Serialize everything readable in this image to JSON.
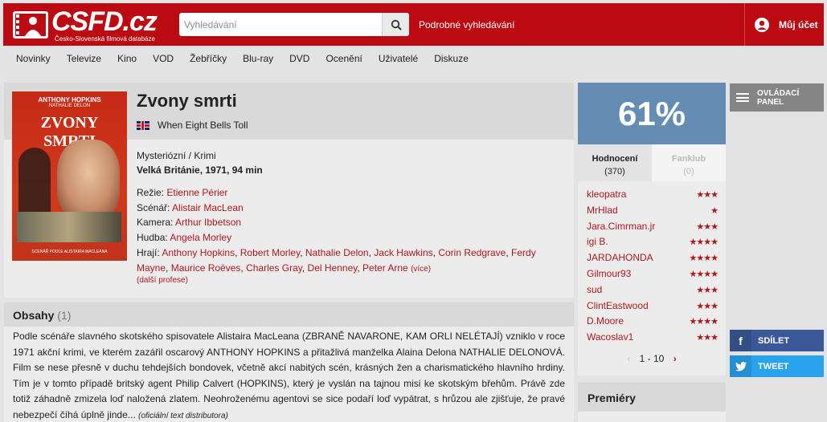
{
  "header": {
    "logo_text": "CSFD.cz",
    "logo_subtitle": "Česko-Slovenská filmová databáze",
    "search_placeholder": "Vyhledávání",
    "advanced_search": "Podrobné vyhledávání",
    "account": "Můj účet"
  },
  "nav": [
    "Novinky",
    "Televize",
    "Kino",
    "VOD",
    "Žebříčky",
    "Blu-ray",
    "DVD",
    "Ocenění",
    "Uživatelé",
    "Diskuze"
  ],
  "film": {
    "poster": {
      "actor": "ANTHONY HOPKINS",
      "actor2": "NATHALIE DELON",
      "title": "ZVONY SMRTI",
      "credit": "SCENÁŘ PODLE ALISTAIRA MACLEANA"
    },
    "title": "Zvony smrti",
    "original_title": "When Eight Bells Toll",
    "genre": "Mysteriózní / Krimi",
    "origin": "Velká Británie, 1971, 94 min",
    "director_label": "Režie:",
    "director": "Etienne Périer",
    "writer_label": "Scénář:",
    "writer": "Alistair MacLean",
    "camera_label": "Kamera:",
    "camera": "Arthur Ibbetson",
    "music_label": "Hudba:",
    "music": "Angela Morley",
    "cast_label": "Hrají:",
    "cast": [
      "Anthony Hopkins",
      "Robert Morley",
      "Nathalie Delon",
      "Jack Hawkins",
      "Corin Redgrave",
      "Ferdy Mayne",
      "Maurice Roëves",
      "Charles Gray",
      "Del Henney",
      "Peter Arne"
    ],
    "cast_more": "(více)",
    "other_professions": "(další profese)"
  },
  "plot": {
    "heading": "Obsahy",
    "count": "(1)",
    "text": "Podle scénáře slavného skotského spisovatele Alistaira MacLeana (ZBRANĚ NAVARONE, KAM ORLI NELÉTAJÍ) vzniklo v roce 1971 akční krimi, ve kterém zazářil oscarový ANTHONY HOPKINS a přitažlivá manželka Alaina Delona NATHALIE DELONOVÁ. Film se nese přesně v duchu tehdejších bondovek, včetně akcí nabitých scén, krásných žen a charismatického hlavního hrdiny. Tím je v tomto případě britský agent Philip Calvert (HOPKINS), který je vyslán na tajnou misi ke skotským břehům. Právě zde totiž záhadně zmizela loď naložená zlatem. Neohroženému agentovi se sice podaří loď vypátrat, s hrůzou ale zjišťuje, že pravé nebezpečí číhá úplně jinde...",
    "source": "(oficiální text distributora)"
  },
  "rating": {
    "percent": "61%",
    "tab_ratings": "Hodnocení",
    "tab_ratings_count": "(370)",
    "tab_fanclub": "Fanklub",
    "tab_fanclub_count": "(0)",
    "users": [
      {
        "name": "kleopatra",
        "stars": "★★★"
      },
      {
        "name": "MrHlad",
        "stars": "★"
      },
      {
        "name": "Jara.Cimrman.jr",
        "stars": "★★★"
      },
      {
        "name": "igi B.",
        "stars": "★★★★"
      },
      {
        "name": "JARDAHONDA",
        "stars": "★★★★"
      },
      {
        "name": "Gilmour93",
        "stars": "★★★★"
      },
      {
        "name": "sud",
        "stars": "★★★"
      },
      {
        "name": "ClintEastwood",
        "stars": "★★★"
      },
      {
        "name": "D.Moore",
        "stars": "★★★★"
      },
      {
        "name": "Wacoslav1",
        "stars": "★★★"
      }
    ],
    "pager": "1 - 10",
    "prev": "‹",
    "next": "›"
  },
  "premieres": {
    "heading": "Premiéry"
  },
  "side": {
    "control_panel_1": "OVLÁDACÍ",
    "control_panel_2": "PANEL",
    "share": "SDÍLET",
    "share_icon": "f",
    "tweet": "TWEET"
  },
  "colors": {
    "brand_red": "#bb0a11",
    "rating_blue": "#658db4",
    "link_red": "#b0171d",
    "facebook": "#3b5998",
    "twitter": "#2aa3ef"
  }
}
